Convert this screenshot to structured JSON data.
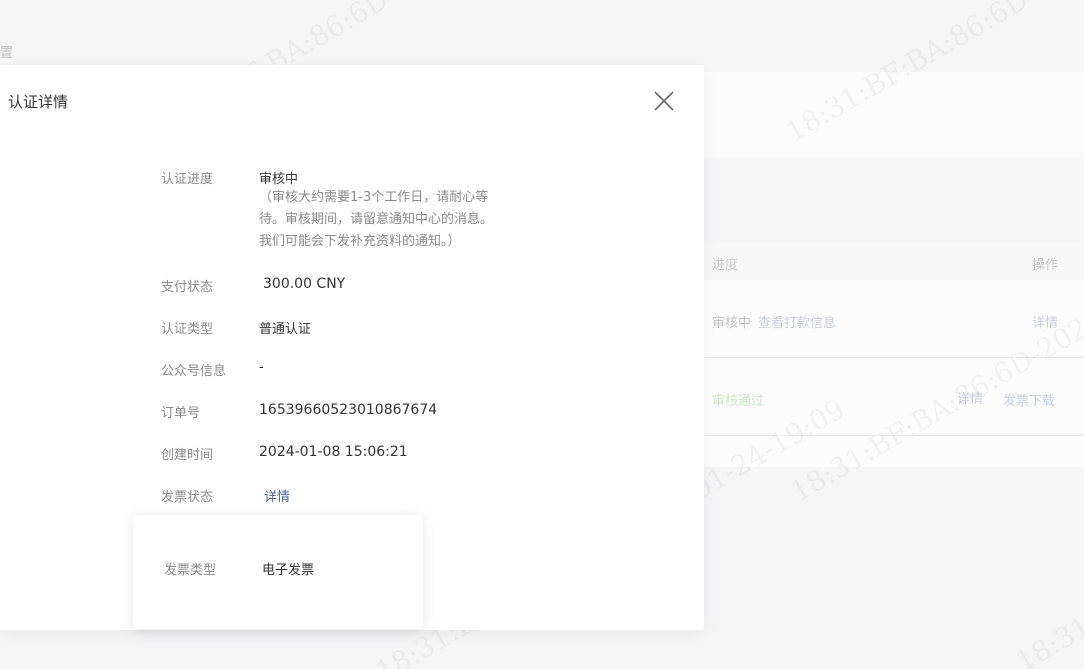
{
  "background": {
    "breadcrumb": "置",
    "table": {
      "headers": {
        "progress": "进度",
        "actions": "操作"
      },
      "rows": [
        {
          "status": "审核中",
          "view_payment": "查看打款信息",
          "detail": "详情"
        },
        {
          "status": "审核通过",
          "detail": "详情",
          "invoice_download": "发票下载"
        }
      ]
    }
  },
  "watermark": "18:31:BF:BA:86:6D-2024-01-24-19:09",
  "modal": {
    "title": "认证详情",
    "fields": [
      {
        "label": "认证进度",
        "value": "审核中"
      },
      {
        "label": "支付状态",
        "value": "300.00 CNY"
      },
      {
        "label": "认证类型",
        "value": "普通认证"
      },
      {
        "label": "公众号信息",
        "value": "-"
      },
      {
        "label": "订单号",
        "value": "16539660523010867674"
      },
      {
        "label": "创建时间",
        "value": "2024-01-08 15:06:21"
      },
      {
        "label": "发票状态",
        "value": "详情"
      }
    ],
    "progress_note": [
      "（审核大约需要1-3个工作日，请耐心等",
      "待。审核期间，请留意通知中心的消息。",
      "我们可能会下发补充资料的通知。）"
    ]
  },
  "popover": {
    "label": "发票类型",
    "value": "电子发票"
  },
  "icons": {
    "close": "close-icon"
  },
  "colors": {
    "link": "#4a6290",
    "approved": "#cfe4c3",
    "label": "#8a8a8a"
  }
}
